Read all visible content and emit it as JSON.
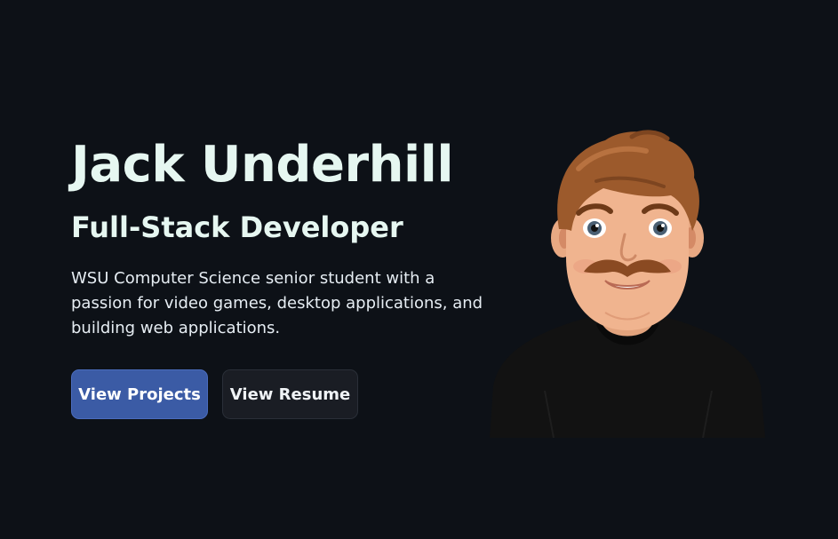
{
  "hero": {
    "name": "Jack Underhill",
    "role": "Full-Stack Developer",
    "description": "WSU Computer Science senior student with a passion for video games, desktop applications, and building web applications.",
    "buttons": {
      "projects_label": "View Projects",
      "resume_label": "View Resume"
    },
    "avatar_icon": "avatar-illustration"
  },
  "colors": {
    "background": "#0d1117",
    "heading": "#e6f7f1",
    "primary_button": "#3b5ba5",
    "secondary_button": "#1a1d24"
  }
}
